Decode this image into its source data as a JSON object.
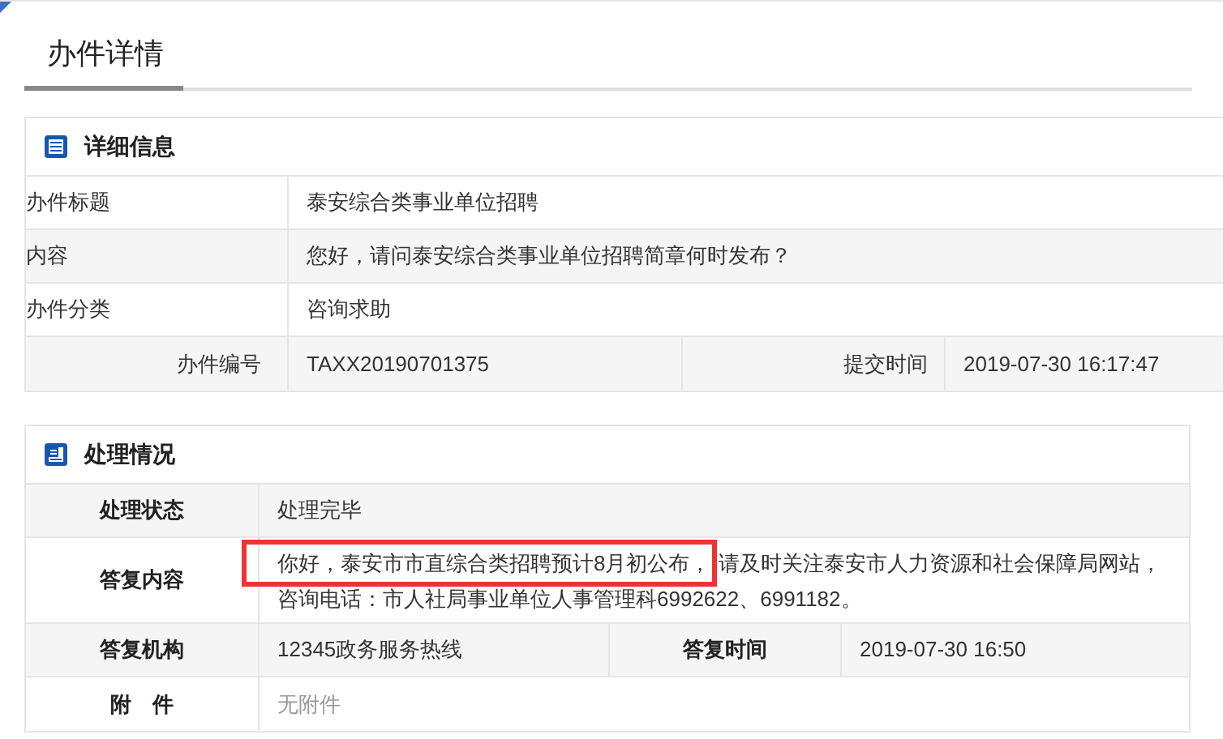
{
  "page_tab": {
    "label": "办件详情",
    "selected": true
  },
  "details": {
    "title": "详细信息",
    "rows": [
      {
        "kind": "wide",
        "label": "办件标题",
        "value": "泰安综合类事业单位招聘"
      },
      {
        "kind": "wide",
        "label": "内容",
        "value": "您好，请问泰安综合类事业单位招聘简章何时发布？"
      },
      {
        "kind": "wide",
        "label": "办件分类",
        "value": "咨询求助"
      },
      {
        "kind": "pair",
        "label": "办件编号",
        "value": "TAXX20190701375",
        "label_2": "提交时间",
        "value_2": "2019-07-30 16:17:47"
      }
    ]
  },
  "handling": {
    "title": "处理情况",
    "rows": [
      {
        "kind": "wide",
        "label": "处理状态",
        "value": "处理完毕"
      },
      {
        "kind": "reply",
        "label": "答复内容",
        "parts": [
          {
            "text": "你好，泰安市市直综合类招聘预计8月初公布，",
            "highlighted": true
          },
          {
            "text": "请及时关注泰安市人力资源和社会保障局网站，咨询电话：市人社局事业单位人事管理科6992622、6991182。",
            "highlighted": false
          }
        ]
      },
      {
        "kind": "pair",
        "label": "答复机构",
        "value": "12345政务服务热线",
        "label_2": "答复时间",
        "value_2": "2019-07-30 16:50"
      },
      {
        "kind": "muted",
        "label": "附　件",
        "value": "无附件"
      }
    ]
  }
}
